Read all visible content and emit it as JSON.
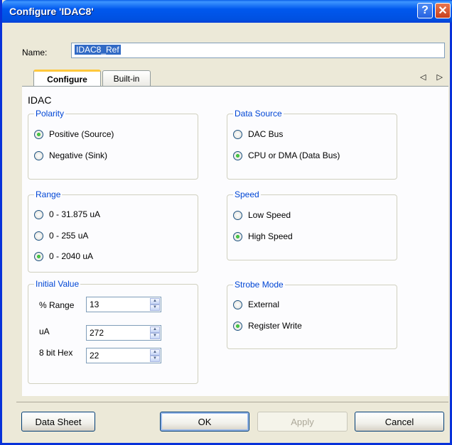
{
  "window": {
    "title": "Configure 'IDAC8'",
    "help_glyph": "?",
    "close_glyph": "✕"
  },
  "name": {
    "label": "Name:",
    "value": "IDAC8_Ref"
  },
  "tabs": {
    "items": [
      "Configure",
      "Built-in"
    ],
    "active": "Configure",
    "arrows": "◁ ▷"
  },
  "panel": {
    "title": "IDAC",
    "polarity": {
      "legend": "Polarity",
      "options": [
        "Positive (Source)",
        "Negative (Sink)"
      ],
      "selected": "Positive (Source)"
    },
    "data_source": {
      "legend": "Data Source",
      "options": [
        "DAC Bus",
        "CPU or DMA (Data Bus)"
      ],
      "selected": "CPU or DMA (Data Bus)"
    },
    "range": {
      "legend": "Range",
      "options": [
        "0 - 31.875 uA",
        "0 - 255 uA",
        "0 - 2040 uA"
      ],
      "selected": "0 - 2040 uA"
    },
    "speed": {
      "legend": "Speed",
      "options": [
        "Low Speed",
        "High Speed"
      ],
      "selected": "High Speed"
    },
    "initial_value": {
      "legend": "Initial Value",
      "fields": [
        {
          "label": "% Range",
          "value": "13"
        },
        {
          "label": "uA",
          "value": "272"
        },
        {
          "label": "8 bit Hex",
          "value": "22"
        }
      ]
    },
    "strobe_mode": {
      "legend": "Strobe Mode",
      "options": [
        "External",
        "Register Write"
      ],
      "selected": "Register Write"
    }
  },
  "buttons": {
    "datasheet": "Data Sheet",
    "ok": "OK",
    "apply": "Apply",
    "cancel": "Cancel"
  },
  "colors": {
    "titlebar": "#0058ee",
    "legend": "#0046d5",
    "window_bg": "#ece9d8",
    "radio_dot": "#21a121"
  }
}
